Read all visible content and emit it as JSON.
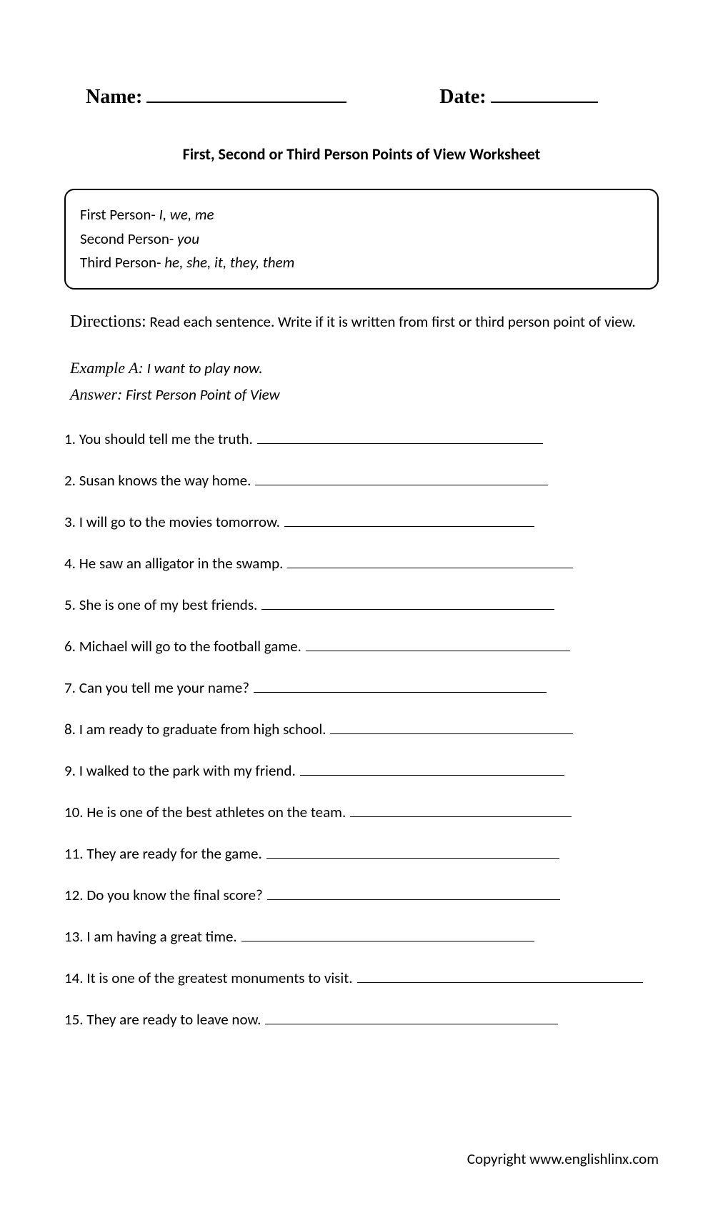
{
  "header": {
    "name_label": "Name:",
    "date_label": "Date:"
  },
  "title": "First, Second or Third Person Points of View Worksheet",
  "info_box": {
    "first_label": "First Person- ",
    "first_pronouns": "I, we, me",
    "second_label": "Second Person- ",
    "second_pronouns": "you",
    "third_label": "Third Person- ",
    "third_pronouns": "he, she, it, they, them"
  },
  "directions": {
    "label": "Directions:",
    "text": "Read each sentence. Write if it is written from first or third person point of view."
  },
  "example": {
    "label_a": "Example A:",
    "text_a": "I want to play now.",
    "label_ans": "Answer:",
    "text_ans": "First Person Point of View"
  },
  "questions": [
    {
      "n": "1.",
      "text": "You should tell me the truth.",
      "line": 400
    },
    {
      "n": "2.",
      "text": "Susan knows the way home.",
      "line": 410
    },
    {
      "n": "3.",
      "text": "I will go to the movies tomorrow.",
      "line": 350
    },
    {
      "n": "4.",
      "text": "He saw an alligator in the swamp.",
      "line": 400
    },
    {
      "n": "5.",
      "text": "She is one of my best friends.",
      "line": 410
    },
    {
      "n": "6.",
      "text": "Michael will go to the football game.",
      "line": 370
    },
    {
      "n": "7.",
      "text": "Can you tell me your name?",
      "line": 410
    },
    {
      "n": "8.",
      "text": "I am ready to graduate from high school.",
      "line": 340
    },
    {
      "n": "9.",
      "text": "I walked to the park with my friend.",
      "line": 370
    },
    {
      "n": "10.",
      "text": "He is one of the best athletes on the team.",
      "line": 310
    },
    {
      "n": "11.",
      "text": "They are ready for the game.",
      "line": 410
    },
    {
      "n": "12.",
      "text": "Do you know the final score?",
      "line": 410
    },
    {
      "n": "13.",
      "text": "I am having a great time.",
      "line": 410
    },
    {
      "n": "14.",
      "text": "It is one of the greatest monuments to visit.",
      "line": 400
    },
    {
      "n": "15.",
      "text": "They are ready to leave now.",
      "line": 410
    }
  ],
  "copyright": "Copyright www.englishlinx.com"
}
